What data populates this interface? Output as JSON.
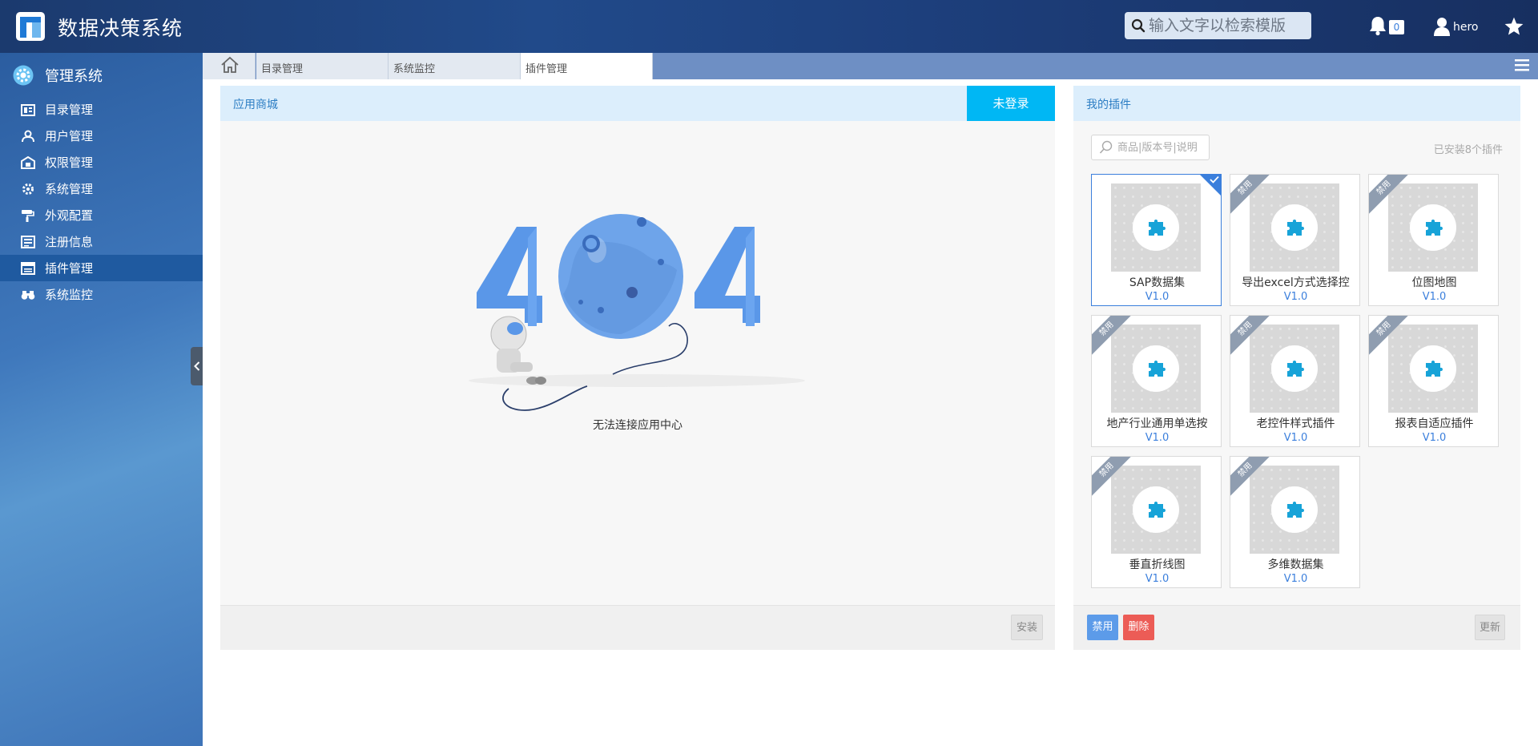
{
  "header": {
    "app_title": "数据决策系统",
    "search_placeholder": "输入文字以检索模版",
    "notification_count": "0",
    "username": "hero"
  },
  "sidebar": {
    "title": "管理系统",
    "items": [
      {
        "label": "目录管理",
        "icon": "catalog-icon"
      },
      {
        "label": "用户管理",
        "icon": "user-icon"
      },
      {
        "label": "权限管理",
        "icon": "permission-icon"
      },
      {
        "label": "系统管理",
        "icon": "gear-icon"
      },
      {
        "label": "外观配置",
        "icon": "paint-roller-icon"
      },
      {
        "label": "注册信息",
        "icon": "register-icon"
      },
      {
        "label": "插件管理",
        "icon": "plugin-list-icon",
        "active": true
      },
      {
        "label": "系统监控",
        "icon": "binoculars-icon"
      }
    ]
  },
  "tabs": [
    {
      "label": "目录管理"
    },
    {
      "label": "系统监控"
    },
    {
      "label": "插件管理",
      "active": true
    }
  ],
  "store": {
    "title": "应用商城",
    "login_label": "未登录",
    "error_message": "无法连接应用中心",
    "install_label": "安装"
  },
  "my_plugins": {
    "title": "我的插件",
    "search_placeholder": "商品|版本号|说明",
    "installed_text": "已安装8个插件",
    "disabled_ribbon": "禁用",
    "plugins": [
      {
        "name": "SAP数据集",
        "version": "V1.0",
        "selected": true,
        "disabled": false
      },
      {
        "name": "导出excel方式选择控",
        "version": "V1.0",
        "disabled": true
      },
      {
        "name": "位图地图",
        "version": "V1.0",
        "disabled": true
      },
      {
        "name": "地产行业通用单选按",
        "version": "V1.0",
        "disabled": true
      },
      {
        "name": "老控件样式插件",
        "version": "V1.0",
        "disabled": true
      },
      {
        "name": "报表自适应插件",
        "version": "V1.0",
        "disabled": true
      },
      {
        "name": "垂直折线图",
        "version": "V1.0",
        "disabled": true
      },
      {
        "name": "多维数据集",
        "version": "V1.0",
        "disabled": true
      }
    ],
    "disable_label": "禁用",
    "delete_label": "删除",
    "update_label": "更新"
  },
  "colors": {
    "accent": "#3b7fdc",
    "login": "#00b7f4",
    "delete": "#ec5c56"
  }
}
